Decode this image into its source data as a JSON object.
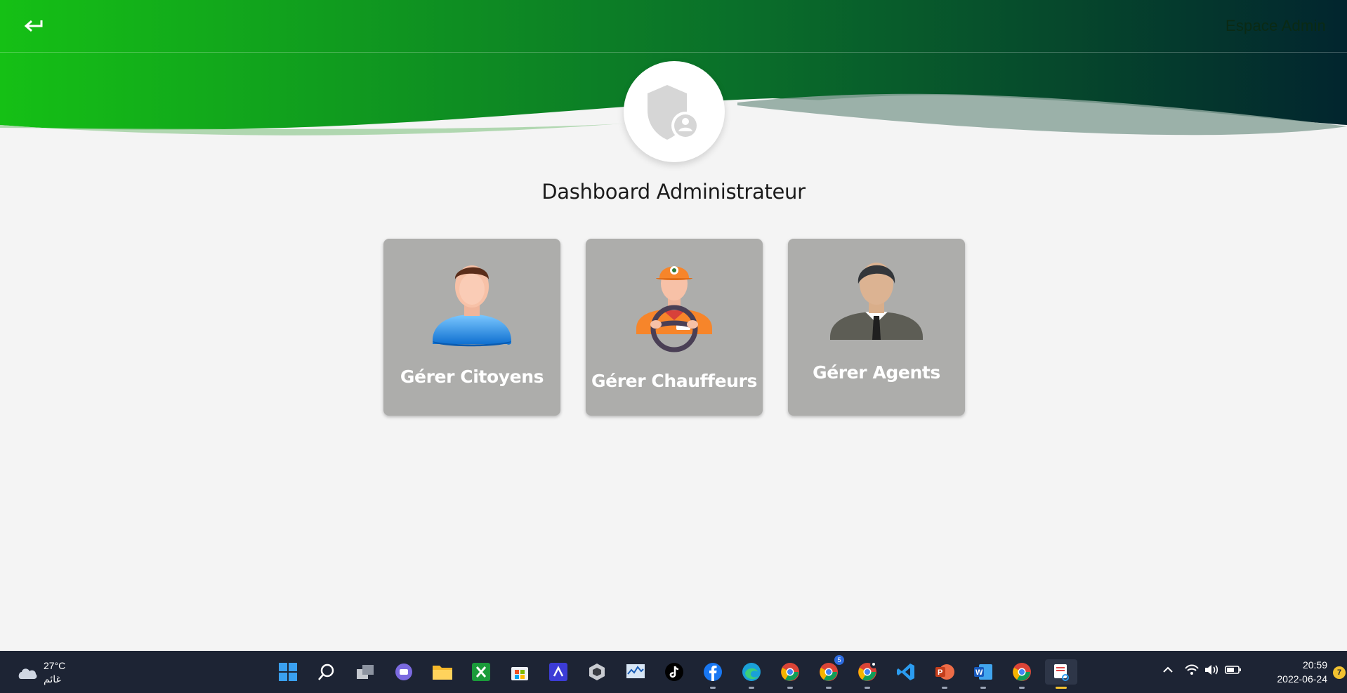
{
  "header": {
    "title": "Espace Admin",
    "back_icon": "back-arrow-icon",
    "gradient_colors": [
      "#15c015",
      "#0a6f2a",
      "#02252e"
    ]
  },
  "avatar": {
    "icon": "shield-user-icon"
  },
  "page_title": "Dashboard Administrateur",
  "cards": [
    {
      "label": "Gérer Citoyens",
      "icon": "citizen-icon"
    },
    {
      "label": "Gérer Chauffeurs",
      "icon": "driver-icon"
    },
    {
      "label": "Gérer Agents",
      "icon": "agent-icon"
    }
  ],
  "taskbar": {
    "weather": {
      "temp": "27°C",
      "condition": "غائم",
      "icon": "cloud-icon"
    },
    "apps": [
      "windows-start-icon",
      "search-icon",
      "task-view-icon",
      "teams-chat-icon",
      "file-explorer-icon",
      "xbox-icon",
      "microsoft-store-icon",
      "vscode-insiders-icon",
      "unity-icon",
      "resource-monitor-icon",
      "tiktok-icon",
      "facebook-icon",
      "edge-icon",
      "chrome-profile-1-icon",
      "chrome-profile-2-icon",
      "chrome-profile-3-icon",
      "vscode-icon",
      "powerpoint-icon",
      "word-icon",
      "chrome-icon",
      "snipping-tool-icon"
    ],
    "badge_count": "5",
    "clock": {
      "time": "20:59",
      "date": "2022-06-24"
    },
    "notifications": "7"
  }
}
